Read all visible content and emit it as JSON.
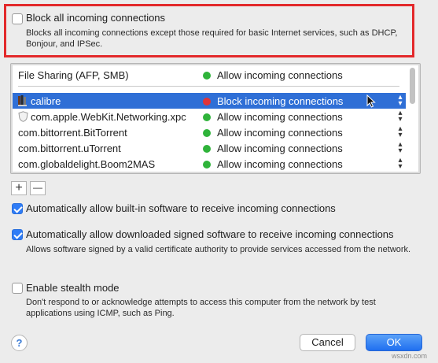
{
  "block_all": {
    "label": "Block all incoming connections",
    "description": "Blocks all incoming connections except those required for basic Internet services,  such as DHCP, Bonjour, and IPSec.",
    "checked": false
  },
  "app_list": {
    "header_row": {
      "name": "File Sharing (AFP, SMB)",
      "status": "Allow incoming connections",
      "status_color": "#2fb33a"
    },
    "rows": [
      {
        "name": "calibre",
        "status": "Block incoming connections",
        "status_color": "#e0343a",
        "icon": "calibre-app-icon",
        "selected": true
      },
      {
        "name": "com.apple.WebKit.Networking.xpc",
        "status": "Allow incoming connections",
        "status_color": "#2fb33a",
        "icon": "shield-app-icon"
      },
      {
        "name": "com.bittorrent.BitTorrent",
        "status": "Allow incoming connections",
        "status_color": "#2fb33a"
      },
      {
        "name": "com.bittorrent.uTorrent",
        "status": "Allow incoming connections",
        "status_color": "#2fb33a"
      },
      {
        "name": "com.globaldelight.Boom2MAS",
        "status": "Allow incoming connections",
        "status_color": "#2fb33a"
      }
    ],
    "add_symbol": "+",
    "remove_symbol": "—"
  },
  "auto_builtin": {
    "label": "Automatically allow built-in software to receive incoming connections",
    "checked": true
  },
  "auto_signed": {
    "label": "Automatically allow downloaded signed software to receive incoming connections",
    "description": "Allows software signed by a valid certificate authority to provide services accessed from the network.",
    "checked": true
  },
  "stealth": {
    "label": "Enable stealth mode",
    "description": "Don't respond to or acknowledge attempts to access this computer from the network by test applications using ICMP, such as Ping.",
    "checked": false
  },
  "buttons": {
    "help": "?",
    "cancel": "Cancel",
    "ok": "OK"
  },
  "watermark": "wsxdn.com",
  "colors": {
    "accent": "#2f7cf6",
    "selection": "#2f6fd6",
    "highlight_border": "#e3292b"
  }
}
